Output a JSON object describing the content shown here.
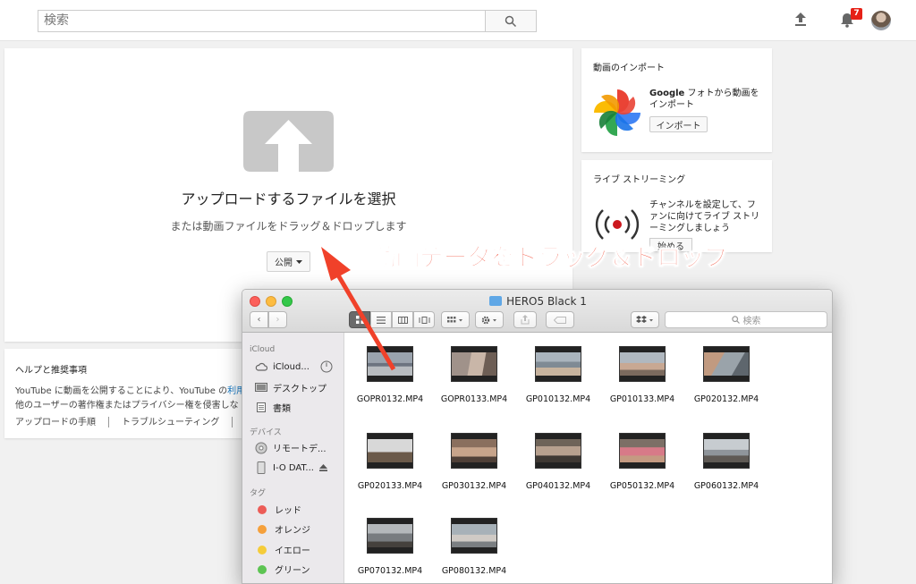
{
  "header": {
    "search_placeholder": "検索",
    "notification_count": "7"
  },
  "upload": {
    "title": "アップロードするファイルを選択",
    "subtitle": "または動画ファイルをドラッグ＆ドロップします",
    "privacy_label": "公開"
  },
  "help": {
    "title": "ヘルプと推奨事項",
    "line1_prefix": "YouTube に動画を公開することにより、YouTube の",
    "line1_link": "利用",
    "line2": "他のユーザーの著作権またはプライバシー権を侵害しな",
    "links": [
      "アップロードの手順",
      "トラブルシューティング"
    ]
  },
  "import": {
    "title": "動画のインポート",
    "source_bold": "Google",
    "source_text": " フォトから動画を インポート",
    "button": "インポート"
  },
  "live": {
    "title": "ライブ ストリーミング",
    "text": "チャンネルを設定して、ファンに向けてライブ ストリーミングしましょう",
    "button": "始める"
  },
  "annotation": "動画データをドラッグ＆ドロップ",
  "finder": {
    "title": "HERO5 Black 1",
    "search_placeholder": "検索",
    "sidebar": {
      "icloud_head": "iCloud",
      "icloud_items": [
        "iCloud...",
        "デスクトップ",
        "書類"
      ],
      "devices_head": "デバイス",
      "device_items": [
        "リモートデ...",
        "I-O DAT..."
      ],
      "tags_head": "タグ",
      "tags": [
        {
          "label": "レッド",
          "color": "#ec5c57"
        },
        {
          "label": "オレンジ",
          "color": "#f5a03b"
        },
        {
          "label": "イエロー",
          "color": "#f5cc3a"
        },
        {
          "label": "グリーン",
          "color": "#5dc453"
        }
      ]
    },
    "files": [
      "GOPR0132.MP4",
      "GOPR0133.MP4",
      "GP010132.MP4",
      "GP010133.MP4",
      "GP020132.MP4",
      "GP020133.MP4",
      "GP030132.MP4",
      "GP040132.MP4",
      "GP050132.MP4",
      "GP060132.MP4",
      "GP070132.MP4",
      "GP080132.MP4"
    ]
  },
  "colors": {
    "accent_red": "#f0412a",
    "notification_red": "#e62117",
    "link_blue": "#167ac6"
  }
}
